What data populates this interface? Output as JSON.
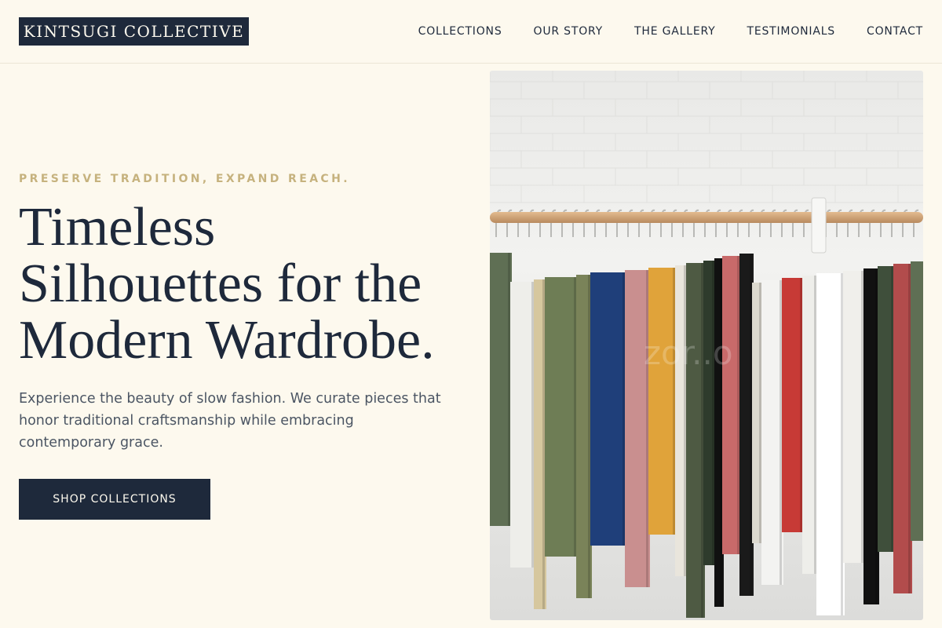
{
  "header": {
    "logo": "KINTSUGI COLLECTIVE",
    "nav": [
      "COLLECTIONS",
      "OUR STORY",
      "THE GALLERY",
      "TESTIMONIALS",
      "CONTACT"
    ]
  },
  "hero": {
    "eyebrow": "PRESERVE TRADITION, EXPAND REACH.",
    "headline_lines": [
      "Timeless",
      "Silhouettes for the",
      "Modern Wardrobe."
    ],
    "lede": "Experience the beauty of slow fashion. We curate pieces that honor traditional craftsmanship while embracing contemporary grace.",
    "cta_label": "SHOP COLLECTIONS",
    "image_watermark": "zor..o"
  },
  "colors": {
    "background": "#fdf9ee",
    "navy": "#1e293b",
    "accent_gold": "#c6b27e",
    "body_text": "#4b5563"
  }
}
